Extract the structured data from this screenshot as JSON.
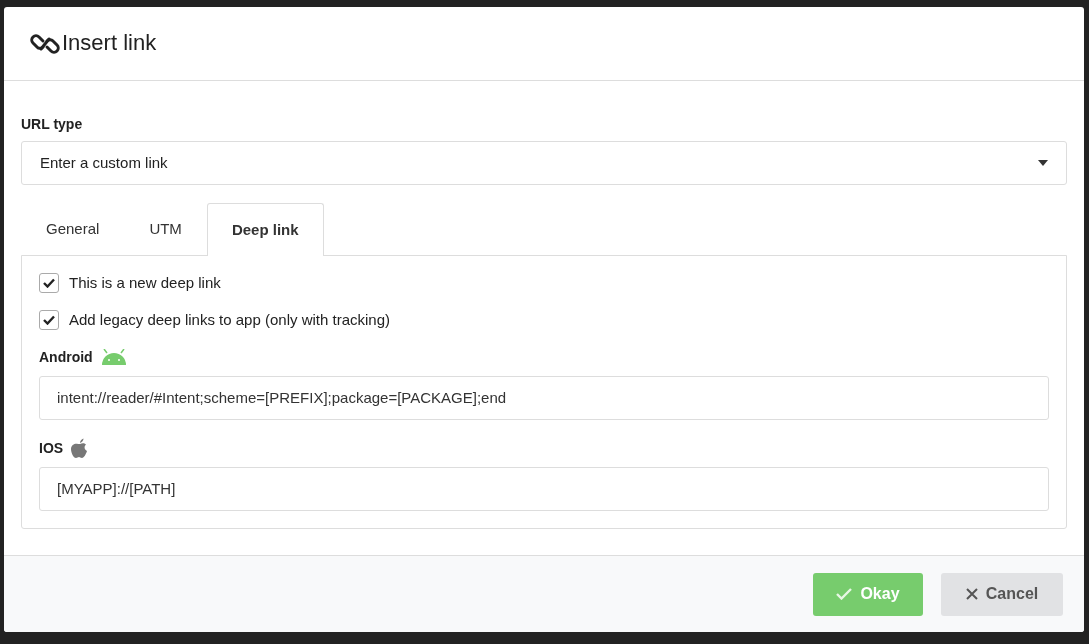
{
  "dialog": {
    "title": "Insert link"
  },
  "url_type": {
    "label": "URL type",
    "value": "Enter a custom link"
  },
  "tabs": [
    {
      "label": "General",
      "selected": false
    },
    {
      "label": "UTM",
      "selected": false
    },
    {
      "label": "Deep link",
      "selected": true
    }
  ],
  "options": [
    {
      "label": "This is a new deep link",
      "checked": true
    },
    {
      "label": "Add legacy deep links to app (only with tracking)",
      "checked": true
    }
  ],
  "platforms": [
    {
      "kind": "android",
      "label": "Android",
      "value": "intent://reader/#Intent;scheme=[PREFIX];package=[PACKAGE];end"
    },
    {
      "kind": "ios",
      "label": "IOS",
      "value": "[MYAPP]://[PATH]"
    }
  ],
  "buttons": [
    {
      "kind": "ok",
      "label": "Okay"
    },
    {
      "kind": "cancel",
      "label": "Cancel"
    }
  ]
}
